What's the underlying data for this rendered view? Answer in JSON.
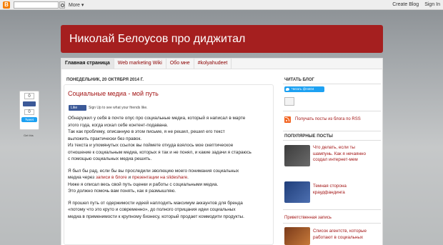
{
  "navbar": {
    "logo_letter": "B",
    "more_label": "More",
    "create_blog": "Create Blog",
    "sign_in": "Sign In"
  },
  "header": {
    "title": "Николай Белоусов про диджитал"
  },
  "tabs": [
    {
      "label": "Главная страница",
      "active": true
    },
    {
      "label": "Web marketing Wiki",
      "active": false
    },
    {
      "label": "Обо мне",
      "active": false
    },
    {
      "label": "#kolyahudeet",
      "active": false
    }
  ],
  "post": {
    "date": "ПОНЕДЕЛЬНИК, 20 ОКТЯБРЯ 2014 Г.",
    "title": "Социальные медиа - мой путь",
    "fb_like": "Like",
    "fb_signup": "Sign Up to see what your friends like.",
    "p1": [
      "Обнаружил у себя в почте опус про социальные медиа, который я написал в марте",
      "этого года, когда искал себе контент-подавана.",
      "Так как проблему, описанную в этом письме, я не решил, решил его текст",
      "выложить практически без правок.",
      "Из текста и упомянутых ссылок вы поймете откуда взялось мое скептическое",
      "отношение к социальным медиа, которых я так и не понял, и какие задачи я стараюсь",
      "с помощью социальных медиа решить."
    ],
    "p2_line1": "Я был бы рад, если бы вы проследили эволюцию моего понимания социальных",
    "p2_line2_a": "медиа через ",
    "p2_line2_link1": "записи в блоге",
    "p2_line2_b": " и ",
    "p2_line2_link2": "презентации на slideshare",
    "p2_line2_c": ".",
    "p2_rest": [
      "Ниже я описал весь свой путь оценки и работы с социальными медиа.",
      "Это должно помочь вам понять, как я размышляю."
    ],
    "p3": [
      "Я прошел путь от одержимости идеей наплодить максимум аккаунтов для бренда",
      "«потому что это круто и современно», до полного отрицания идеи социальных",
      "медиа в применимости к крупному бизнесу, который продает коммодити продукты."
    ]
  },
  "share": {
    "count1": "0",
    "count2": "0",
    "tweet": "Tweet",
    "get_this": "Get this"
  },
  "sidebar": {
    "follow_heading": "ЧИТАТЬ БЛОГ",
    "twitter_follow": "Читать @nt404",
    "rss_link": "Получать посты из блога по RSS",
    "popular_heading": "ПОПУЛЯРНЫЕ ПОСТЫ",
    "popular": [
      {
        "title_lines": [
          "Что делать, если ты",
          "шампунь. Как я нечаянно",
          "создал интернет-мем"
        ]
      },
      {
        "title_lines": [
          "Темная сторона",
          "краудфандинга"
        ]
      },
      {
        "title_lines": [
          "Список агентств, которые",
          "работают в социальных"
        ]
      }
    ],
    "welcome_heading": "Приветственная запись"
  },
  "colors": {
    "header_bg": "#a51f1f",
    "link": "#a31616",
    "facebook": "#3b5998",
    "twitter": "#1da1f2",
    "rss": "#f26522"
  }
}
